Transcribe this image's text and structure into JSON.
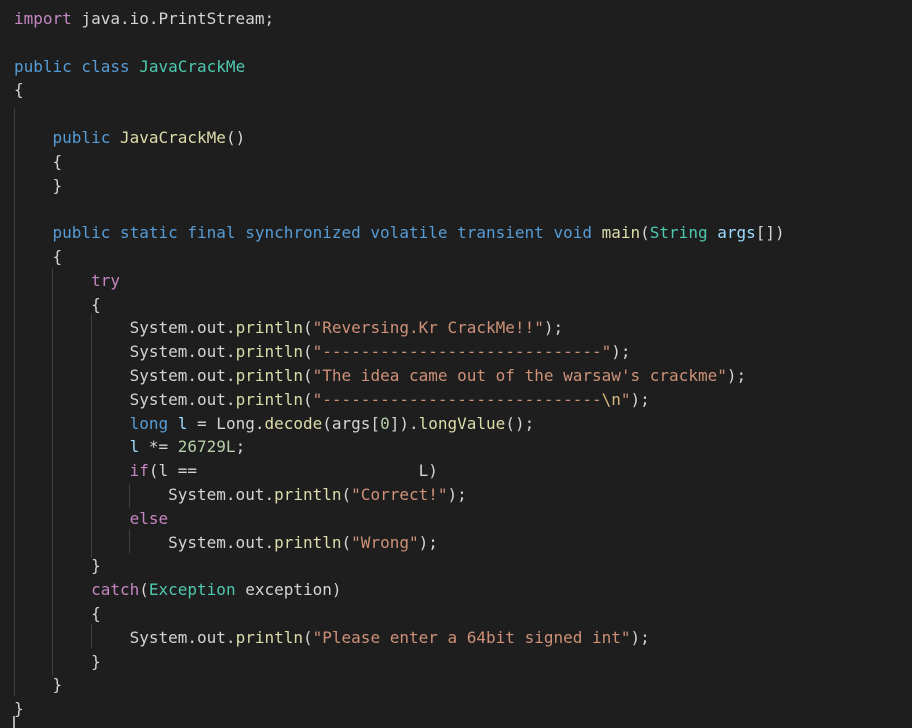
{
  "editor": {
    "lines": [
      {
        "tokens": [
          {
            "t": "import",
            "c": "kw2"
          },
          {
            "t": " java.io.PrintStream;",
            "c": "plain"
          }
        ]
      },
      {
        "tokens": []
      },
      {
        "tokens": [
          {
            "t": "public",
            "c": "kw"
          },
          {
            "t": " class ",
            "c": "kw"
          },
          {
            "t": "JavaCrackMe",
            "c": "type"
          }
        ]
      },
      {
        "tokens": [
          {
            "t": "{",
            "c": "plain"
          }
        ]
      },
      {
        "tokens": []
      },
      {
        "tokens": [
          {
            "t": "    public ",
            "c": "kw"
          },
          {
            "t": "JavaCrackMe",
            "c": "fn"
          },
          {
            "t": "()",
            "c": "plain"
          }
        ]
      },
      {
        "tokens": [
          {
            "t": "    {",
            "c": "plain"
          }
        ]
      },
      {
        "tokens": [
          {
            "t": "    }",
            "c": "plain"
          }
        ]
      },
      {
        "tokens": []
      },
      {
        "tokens": [
          {
            "t": "    public static final synchronized volatile transient void ",
            "c": "kw"
          },
          {
            "t": "main",
            "c": "fn"
          },
          {
            "t": "(",
            "c": "plain"
          },
          {
            "t": "String",
            "c": "type"
          },
          {
            "t": " args",
            "c": "var"
          },
          {
            "t": "[])",
            "c": "plain"
          }
        ]
      },
      {
        "tokens": [
          {
            "t": "    {",
            "c": "plain"
          }
        ]
      },
      {
        "tokens": [
          {
            "t": "        try",
            "c": "kw2"
          }
        ]
      },
      {
        "tokens": [
          {
            "t": "        {",
            "c": "plain"
          }
        ]
      },
      {
        "tokens": [
          {
            "t": "            System.out.",
            "c": "plain"
          },
          {
            "t": "println",
            "c": "fn"
          },
          {
            "t": "(",
            "c": "plain"
          },
          {
            "t": "\"Reversing.Kr CrackMe!!\"",
            "c": "str"
          },
          {
            "t": ");",
            "c": "plain"
          }
        ]
      },
      {
        "tokens": [
          {
            "t": "            System.out.",
            "c": "plain"
          },
          {
            "t": "println",
            "c": "fn"
          },
          {
            "t": "(",
            "c": "plain"
          },
          {
            "t": "\"-----------------------------\"",
            "c": "str"
          },
          {
            "t": ");",
            "c": "plain"
          }
        ]
      },
      {
        "tokens": [
          {
            "t": "            System.out.",
            "c": "plain"
          },
          {
            "t": "println",
            "c": "fn"
          },
          {
            "t": "(",
            "c": "plain"
          },
          {
            "t": "\"The idea came out of the warsaw's crackme\"",
            "c": "str"
          },
          {
            "t": ");",
            "c": "plain"
          }
        ]
      },
      {
        "tokens": [
          {
            "t": "            System.out.",
            "c": "plain"
          },
          {
            "t": "println",
            "c": "fn"
          },
          {
            "t": "(",
            "c": "plain"
          },
          {
            "t": "\"-----------------------------",
            "c": "str"
          },
          {
            "t": "\\n",
            "c": "esc"
          },
          {
            "t": "\"",
            "c": "str"
          },
          {
            "t": ");",
            "c": "plain"
          }
        ]
      },
      {
        "tokens": [
          {
            "t": "            long ",
            "c": "kw"
          },
          {
            "t": "l",
            "c": "var"
          },
          {
            "t": " = Long.",
            "c": "plain"
          },
          {
            "t": "decode",
            "c": "fn"
          },
          {
            "t": "(args[",
            "c": "plain"
          },
          {
            "t": "0",
            "c": "num"
          },
          {
            "t": "]).",
            "c": "plain"
          },
          {
            "t": "longValue",
            "c": "fn"
          },
          {
            "t": "();",
            "c": "plain"
          }
        ]
      },
      {
        "tokens": [
          {
            "t": "            l",
            "c": "var"
          },
          {
            "t": " *= ",
            "c": "plain"
          },
          {
            "t": "26729L",
            "c": "num"
          },
          {
            "t": ";",
            "c": "plain"
          }
        ]
      },
      {
        "tokens": [
          {
            "t": "            if",
            "c": "kw2"
          },
          {
            "t": "(l ==                       L)",
            "c": "plain"
          }
        ]
      },
      {
        "tokens": [
          {
            "t": "                System.out.",
            "c": "plain"
          },
          {
            "t": "println",
            "c": "fn"
          },
          {
            "t": "(",
            "c": "plain"
          },
          {
            "t": "\"Correct!\"",
            "c": "str"
          },
          {
            "t": ");",
            "c": "plain"
          }
        ]
      },
      {
        "tokens": [
          {
            "t": "            else",
            "c": "kw2"
          }
        ]
      },
      {
        "tokens": [
          {
            "t": "                System.out.",
            "c": "plain"
          },
          {
            "t": "println",
            "c": "fn"
          },
          {
            "t": "(",
            "c": "plain"
          },
          {
            "t": "\"Wrong\"",
            "c": "str"
          },
          {
            "t": ");",
            "c": "plain"
          }
        ]
      },
      {
        "tokens": [
          {
            "t": "        }",
            "c": "plain"
          }
        ]
      },
      {
        "tokens": [
          {
            "t": "        catch",
            "c": "kw2"
          },
          {
            "t": "(",
            "c": "plain"
          },
          {
            "t": "Exception",
            "c": "type"
          },
          {
            "t": " exception)",
            "c": "plain"
          }
        ]
      },
      {
        "tokens": [
          {
            "t": "        {",
            "c": "plain"
          }
        ]
      },
      {
        "tokens": [
          {
            "t": "            System.out.",
            "c": "plain"
          },
          {
            "t": "println",
            "c": "fn"
          },
          {
            "t": "(",
            "c": "plain"
          },
          {
            "t": "\"Please enter a 64bit signed int\"",
            "c": "str"
          },
          {
            "t": ");",
            "c": "plain"
          }
        ]
      },
      {
        "tokens": [
          {
            "t": "        }",
            "c": "plain"
          }
        ]
      },
      {
        "tokens": [
          {
            "t": "    }",
            "c": "plain"
          }
        ]
      },
      {
        "tokens": [
          {
            "t": "}",
            "c": "plain"
          }
        ]
      }
    ]
  }
}
